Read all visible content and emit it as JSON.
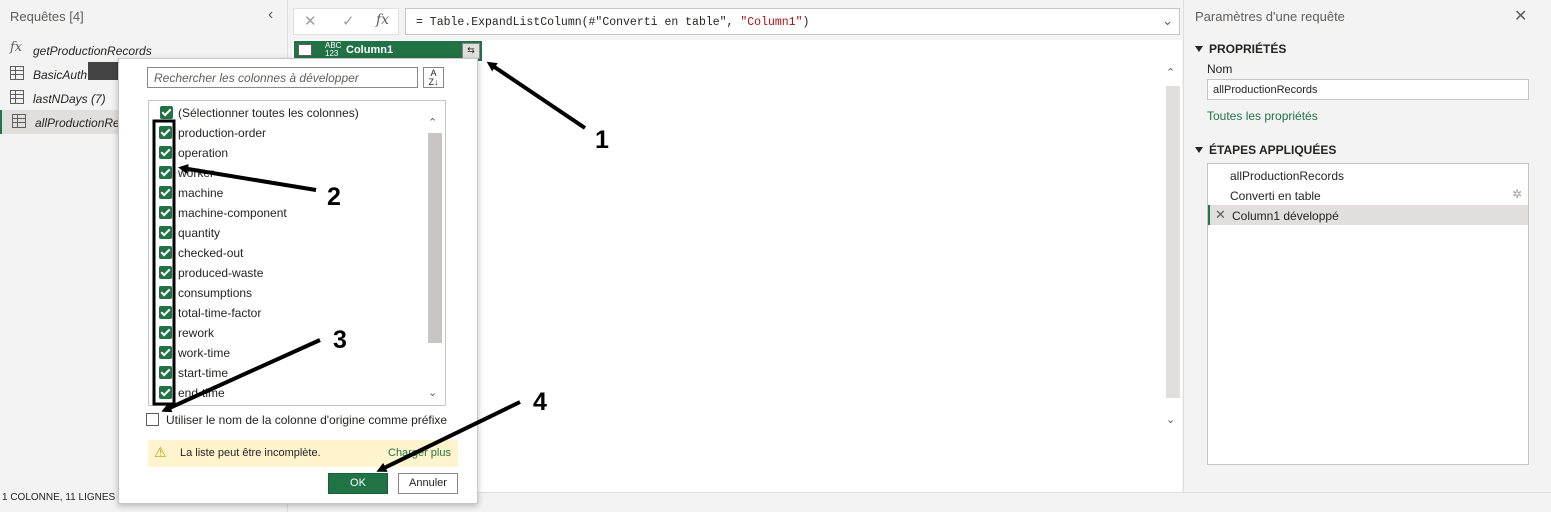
{
  "queries": {
    "title": "Requêtes [4]",
    "items": [
      {
        "label": "getProductionRecords",
        "icon": "fx-icon"
      },
      {
        "label": "BasicAuth",
        "icon": "table-icon"
      },
      {
        "label": "lastNDays (7)",
        "icon": "table-icon"
      },
      {
        "label": "allProductionRec",
        "icon": "table-icon"
      }
    ],
    "status": "1 COLONNE, 11 LIGNES"
  },
  "formula": {
    "prefix": "= Table.ExpandListColumn(#\"Converti en table\", ",
    "arg": "\"Column1\"",
    "suffix": ")",
    "fx": "fx"
  },
  "column": {
    "type": "ABC 123",
    "type_line1": "ABC",
    "type_line2": "123",
    "name": "Column1"
  },
  "expand_dialog": {
    "search_placeholder": "Rechercher les colonnes à développer",
    "select_all": "(Sélectionner toutes les colonnes)",
    "columns": [
      "production-order",
      "operation",
      "worker",
      "machine",
      "machine-component",
      "quantity",
      "checked-out",
      "produced-waste",
      "consumptions",
      "total-time-factor",
      "rework",
      "work-time",
      "start-time",
      "end-time"
    ],
    "prefix_option": "Utiliser le nom de la colonne d'origine comme préfixe",
    "prefix_checked": false,
    "warning": "La liste peut être incomplète.",
    "load_more": "Charger plus",
    "ok": "OK",
    "cancel": "Annuler"
  },
  "properties": {
    "title": "Paramètres d'une requête",
    "section_props": "PROPRIÉTÉS",
    "name_label": "Nom",
    "name_value": "allProductionRecords",
    "all_props_link": "Toutes les propriétés",
    "section_steps": "ÉTAPES APPLIQUÉES",
    "steps": [
      {
        "label": "allProductionRecords"
      },
      {
        "label": "Converti en table"
      },
      {
        "label": "Column1 développé"
      }
    ]
  },
  "annotations": [
    "1",
    "2",
    "3",
    "4"
  ],
  "colors": {
    "accent": "#217346",
    "warning_bg": "#fff4ce"
  }
}
